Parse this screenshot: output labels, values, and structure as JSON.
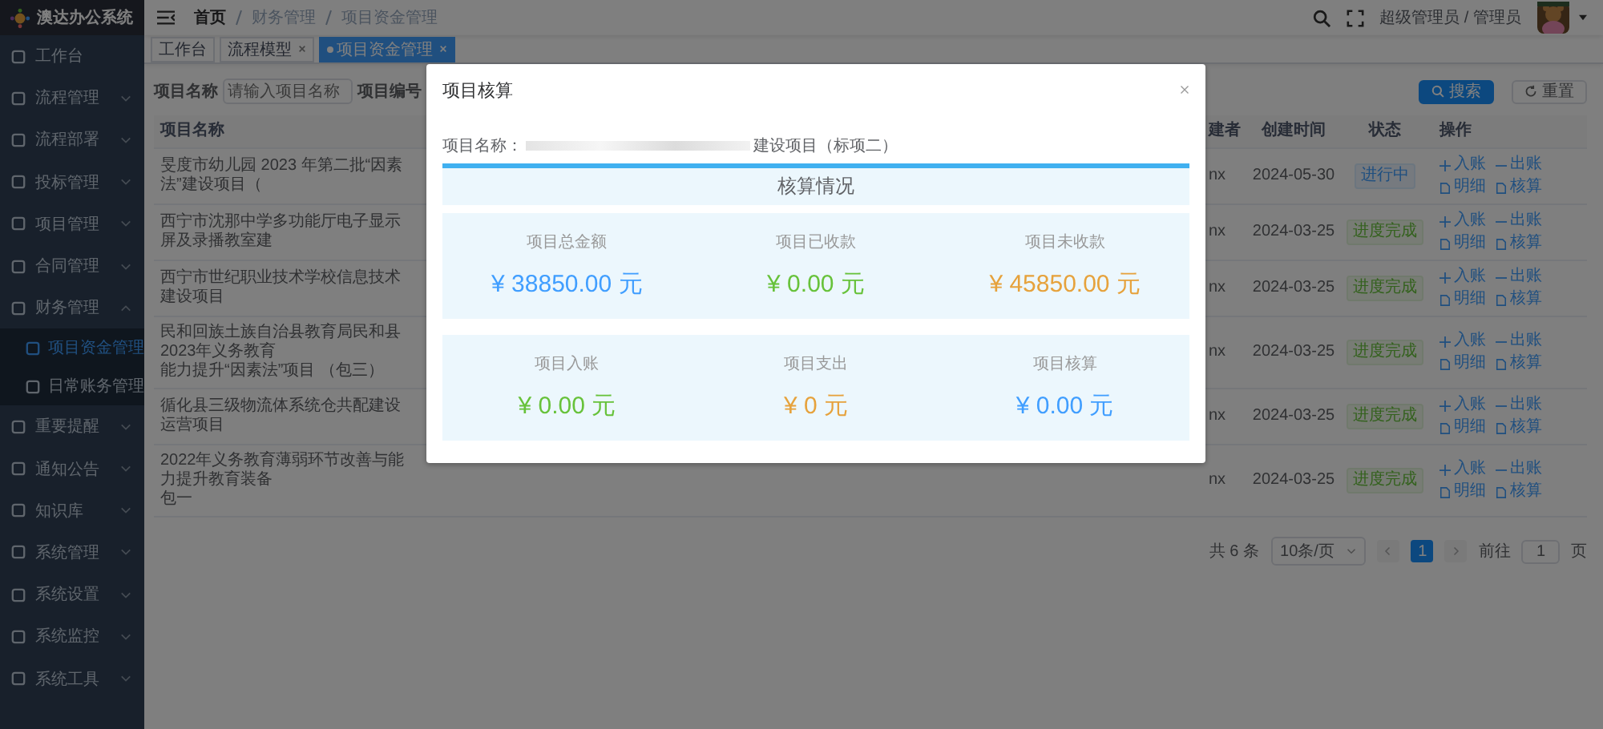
{
  "sidebar": {
    "title": "澳达办公系统",
    "items": [
      {
        "label": "工作台",
        "kind": "link"
      },
      {
        "label": "流程管理",
        "kind": "menu",
        "expanded": false
      },
      {
        "label": "流程部署",
        "kind": "menu",
        "expanded": false
      },
      {
        "label": "投标管理",
        "kind": "menu",
        "expanded": false
      },
      {
        "label": "项目管理",
        "kind": "menu",
        "expanded": false
      },
      {
        "label": "合同管理",
        "kind": "menu",
        "expanded": false
      },
      {
        "label": "财务管理",
        "kind": "menu",
        "expanded": true,
        "children": [
          {
            "label": "项目资金管理",
            "selected": true
          },
          {
            "label": "日常账务管理",
            "selected": false
          }
        ]
      },
      {
        "label": "重要提醒",
        "kind": "menu",
        "expanded": false
      },
      {
        "label": "通知公告",
        "kind": "menu",
        "expanded": false
      },
      {
        "label": "知识库",
        "kind": "menu",
        "expanded": false
      },
      {
        "label": "系统管理",
        "kind": "menu",
        "expanded": false
      },
      {
        "label": "系统设置",
        "kind": "menu",
        "expanded": false
      },
      {
        "label": "系统监控",
        "kind": "menu",
        "expanded": false
      },
      {
        "label": "系统工具",
        "kind": "menu",
        "expanded": false
      }
    ]
  },
  "navbar": {
    "breadcrumbs": [
      "首页",
      "财务管理",
      "项目资金管理"
    ],
    "user": "超级管理员 / 管理员"
  },
  "tags": [
    {
      "label": "工作台",
      "selected": false,
      "closable": false
    },
    {
      "label": "流程模型",
      "selected": false,
      "closable": true
    },
    {
      "label": "项目资金管理",
      "selected": true,
      "closable": true
    }
  ],
  "search": {
    "fields": [
      {
        "label": "项目名称",
        "placeholder": "请输入项目名称"
      },
      {
        "label": "项目编号"
      }
    ],
    "buttons": [
      {
        "label": "搜索",
        "kind": "primary"
      },
      {
        "label": "重置",
        "kind": "default"
      }
    ]
  },
  "table": {
    "columns": [
      "项目名称",
      "建者",
      "创建时间",
      "状态",
      "操作"
    ],
    "rows": [
      {
        "name": [
          "旻度市幼儿园 2023 年第二批“因素法”建设项目（"
        ],
        "creator": "nx",
        "created": "2024-05-30",
        "status": {
          "label": "进行中",
          "kind": "progress"
        },
        "actions": [
          {
            "label": "入账",
            "kind": "plus"
          },
          {
            "label": "出账",
            "kind": "minus"
          },
          {
            "label": "明细",
            "kind": "doc"
          },
          {
            "label": "核算",
            "kind": "doc"
          }
        ]
      },
      {
        "name": [
          "西宁市沈那中学多功能厅电子显示屏及录播教室建"
        ],
        "creator": "nx",
        "created": "2024-03-25",
        "status": {
          "label": "进度完成",
          "kind": "done"
        },
        "actions": [
          {
            "label": "入账",
            "kind": "plus"
          },
          {
            "label": "出账",
            "kind": "minus"
          },
          {
            "label": "明细",
            "kind": "doc"
          },
          {
            "label": "核算",
            "kind": "doc"
          }
        ]
      },
      {
        "name": [
          "西宁市世纪职业技术学校信息技术建设项目"
        ],
        "creator": "nx",
        "created": "2024-03-25",
        "status": {
          "label": "进度完成",
          "kind": "done"
        },
        "actions": [
          {
            "label": "入账",
            "kind": "plus"
          },
          {
            "label": "出账",
            "kind": "minus"
          },
          {
            "label": "明细",
            "kind": "doc"
          },
          {
            "label": "核算",
            "kind": "doc"
          }
        ]
      },
      {
        "name": [
          "民和回族土族自治县教育局民和县2023年义务教育",
          "能力提升“因素法”项目 （包三）"
        ],
        "creator": "nx",
        "created": "2024-03-25",
        "status": {
          "label": "进度完成",
          "kind": "done"
        },
        "actions": [
          {
            "label": "入账",
            "kind": "plus"
          },
          {
            "label": "出账",
            "kind": "minus"
          },
          {
            "label": "明细",
            "kind": "doc"
          },
          {
            "label": "核算",
            "kind": "doc"
          }
        ]
      },
      {
        "name": [
          "循化县三级物流体系统仓共配建设运营项目"
        ],
        "creator": "nx",
        "created": "2024-03-25",
        "status": {
          "label": "进度完成",
          "kind": "done"
        },
        "actions": [
          {
            "label": "入账",
            "kind": "plus"
          },
          {
            "label": "出账",
            "kind": "minus"
          },
          {
            "label": "明细",
            "kind": "doc"
          },
          {
            "label": "核算",
            "kind": "doc"
          }
        ]
      },
      {
        "name": [
          "2022年义务教育薄弱环节改善与能力提升教育装备",
          "包一"
        ],
        "creator": "nx",
        "created": "2024-03-25",
        "status": {
          "label": "进度完成",
          "kind": "done"
        },
        "actions": [
          {
            "label": "入账",
            "kind": "plus"
          },
          {
            "label": "出账",
            "kind": "minus"
          },
          {
            "label": "明细",
            "kind": "doc"
          },
          {
            "label": "核算",
            "kind": "doc"
          }
        ]
      }
    ]
  },
  "pagination": {
    "total": "共 6 条",
    "page_size": "10条/页",
    "pages": [
      {
        "label": "1",
        "selected": true
      }
    ],
    "goto_label": "前往",
    "goto_value": "1",
    "goto_unit": "页"
  },
  "dialog": {
    "title": "项目核算",
    "name_label": "项目名称：",
    "name_value": "建设项目（标项二）",
    "section_title": "核算情况",
    "panels": [
      [
        {
          "label": "项目总金额",
          "value": "¥ 38850.00 元",
          "color": "#409eff"
        },
        {
          "label": "项目已收款",
          "value": "¥ 0.00 元",
          "color": "#67c23a"
        },
        {
          "label": "项目未收款",
          "value": "¥ 45850.00 元",
          "color": "#e6a23c"
        }
      ],
      [
        {
          "label": "项目入账",
          "value": "¥ 0.00 元",
          "color": "#67c23a"
        },
        {
          "label": "项目支出",
          "value": "¥ 0 元",
          "color": "#e6a23c"
        },
        {
          "label": "项目核算",
          "value": "¥ 0.00 元",
          "color": "#409eff"
        }
      ]
    ]
  }
}
